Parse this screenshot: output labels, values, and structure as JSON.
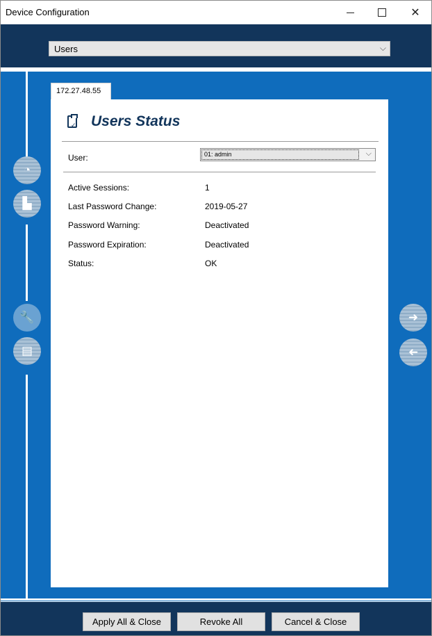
{
  "window": {
    "title": "Device Configuration"
  },
  "module_select": {
    "value": "Users"
  },
  "tab": {
    "label": "172.27.48.55"
  },
  "panel": {
    "title": "Users Status",
    "user_label": "User:",
    "user_value": "01: admin",
    "rows": [
      {
        "label": "Active Sessions:",
        "value": "1"
      },
      {
        "label": "Last Password Change:",
        "value": "2019-05-27"
      },
      {
        "label": "Password Warning:",
        "value": "Deactivated"
      },
      {
        "label": "Password Expiration:",
        "value": "Deactivated"
      },
      {
        "label": "Status:",
        "value": "OK"
      }
    ]
  },
  "footer": {
    "apply_label": "Apply All & Close",
    "revoke_label": "Revoke All",
    "cancel_label": "Cancel & Close"
  },
  "colors": {
    "navy": "#12355b",
    "blue": "#0f6cbc"
  }
}
